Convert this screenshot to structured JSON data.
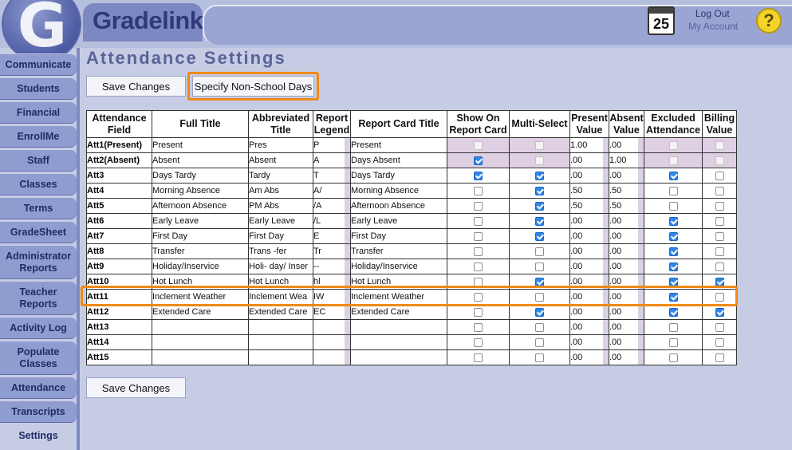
{
  "header": {
    "brand": "Gradelink",
    "calendar_day": "25",
    "logout": "Log Out",
    "my_account": "My Account",
    "help": "?"
  },
  "sidebar": {
    "items": [
      {
        "label": "Communicate"
      },
      {
        "label": "Students"
      },
      {
        "label": "Financial"
      },
      {
        "label": "EnrollMe"
      },
      {
        "label": "Staff"
      },
      {
        "label": "Classes"
      },
      {
        "label": "Terms"
      },
      {
        "label": "GradeSheet"
      },
      {
        "label": "Administrator Reports"
      },
      {
        "label": "Teacher Reports"
      },
      {
        "label": "Activity Log"
      },
      {
        "label": "Populate Classes"
      },
      {
        "label": "Attendance"
      },
      {
        "label": "Transcripts"
      },
      {
        "label": "Settings"
      }
    ]
  },
  "main": {
    "title": "Attendance Settings",
    "save_label": "Save Changes",
    "nonschool_label": "Specify Non-School Days",
    "headers": {
      "field": "Attendance Field",
      "full": "Full Title",
      "abbr": "Abbreviated Title",
      "legend": "Report Legend",
      "rc_title": "Report Card Title",
      "show": "Show On Report Card",
      "multi": "Multi-Select",
      "present": "Present Value",
      "absent": "Absent Value",
      "excluded": "Excluded Attendance",
      "billing": "Billing Value"
    },
    "rows": [
      {
        "code": "Att1(Present)",
        "full": "Present",
        "abbr": "Pres",
        "legend": "P",
        "rc": "Present",
        "show": false,
        "multi": false,
        "present": "1.00",
        "absent": ".00",
        "excluded": false,
        "billing": false
      },
      {
        "code": "Att2(Absent)",
        "full": "Absent",
        "abbr": "Absent",
        "legend": "A",
        "rc": "Days Absent",
        "show": true,
        "multi": false,
        "present": ".00",
        "absent": "1.00",
        "excluded": false,
        "billing": false
      },
      {
        "code": "Att3",
        "full": "Days Tardy",
        "abbr": "Tardy",
        "legend": "T",
        "rc": "Days Tardy",
        "show": true,
        "multi": true,
        "present": ".00",
        "absent": ".00",
        "excluded": true,
        "billing": false
      },
      {
        "code": "Att4",
        "full": "Morning Absence",
        "abbr": "Am Abs",
        "legend": "A/",
        "rc": "Morning Absence",
        "show": false,
        "multi": true,
        "present": ".50",
        "absent": ".50",
        "excluded": false,
        "billing": false
      },
      {
        "code": "Att5",
        "full": "Afternoon  Absence",
        "abbr": "PM Abs",
        "legend": "/A",
        "rc": "Afternoon  Absence",
        "show": false,
        "multi": true,
        "present": ".50",
        "absent": ".50",
        "excluded": false,
        "billing": false
      },
      {
        "code": "Att6",
        "full": "Early Leave",
        "abbr": "Early Leave",
        "legend": "/L",
        "rc": "Early Leave",
        "show": false,
        "multi": true,
        "present": ".00",
        "absent": ".00",
        "excluded": true,
        "billing": false
      },
      {
        "code": "Att7",
        "full": "First Day",
        "abbr": "First Day",
        "legend": "E",
        "rc": "First Day",
        "show": false,
        "multi": true,
        "present": ".00",
        "absent": ".00",
        "excluded": true,
        "billing": false
      },
      {
        "code": "Att8",
        "full": "Transfer",
        "abbr": "Trans -fer",
        "legend": "Tr",
        "rc": "Transfer",
        "show": false,
        "multi": false,
        "present": ".00",
        "absent": ".00",
        "excluded": true,
        "billing": false
      },
      {
        "code": "Att9",
        "full": "Holiday/Inservice",
        "abbr": "Holi- day/ Inser",
        "legend": "--",
        "rc": "Holiday/Inservice",
        "show": false,
        "multi": false,
        "present": ".00",
        "absent": ".00",
        "excluded": true,
        "billing": false
      },
      {
        "code": "Att10",
        "full": "Hot Lunch",
        "abbr": "Hot Lunch",
        "legend": "hl",
        "rc": "Hot Lunch",
        "show": false,
        "multi": true,
        "present": ".00",
        "absent": ".00",
        "excluded": true,
        "billing": true
      },
      {
        "code": "Att11",
        "full": "Inclement Weather",
        "abbr": "Inclement Wea",
        "legend": "IW",
        "rc": "Inclement Weather",
        "show": false,
        "multi": false,
        "present": ".00",
        "absent": ".00",
        "excluded": true,
        "billing": false
      },
      {
        "code": "Att12",
        "full": "Extended Care",
        "abbr": "Extended Care",
        "legend": "EC",
        "rc": "Extended Care",
        "show": false,
        "multi": true,
        "present": ".00",
        "absent": ".00",
        "excluded": true,
        "billing": true
      },
      {
        "code": "Att13",
        "full": "",
        "abbr": "",
        "legend": "",
        "rc": "",
        "show": false,
        "multi": false,
        "present": ".00",
        "absent": ".00",
        "excluded": false,
        "billing": false
      },
      {
        "code": "Att14",
        "full": "",
        "abbr": "",
        "legend": "",
        "rc": "",
        "show": false,
        "multi": false,
        "present": ".00",
        "absent": ".00",
        "excluded": false,
        "billing": false
      },
      {
        "code": "Att15",
        "full": "",
        "abbr": "",
        "legend": "",
        "rc": "",
        "show": false,
        "multi": false,
        "present": ".00",
        "absent": ".00",
        "excluded": false,
        "billing": false
      }
    ]
  },
  "colors": {
    "highlight": "#f08a12",
    "checkbox_checked": "#2f86e8",
    "pink_row": "#dfcfe3"
  }
}
